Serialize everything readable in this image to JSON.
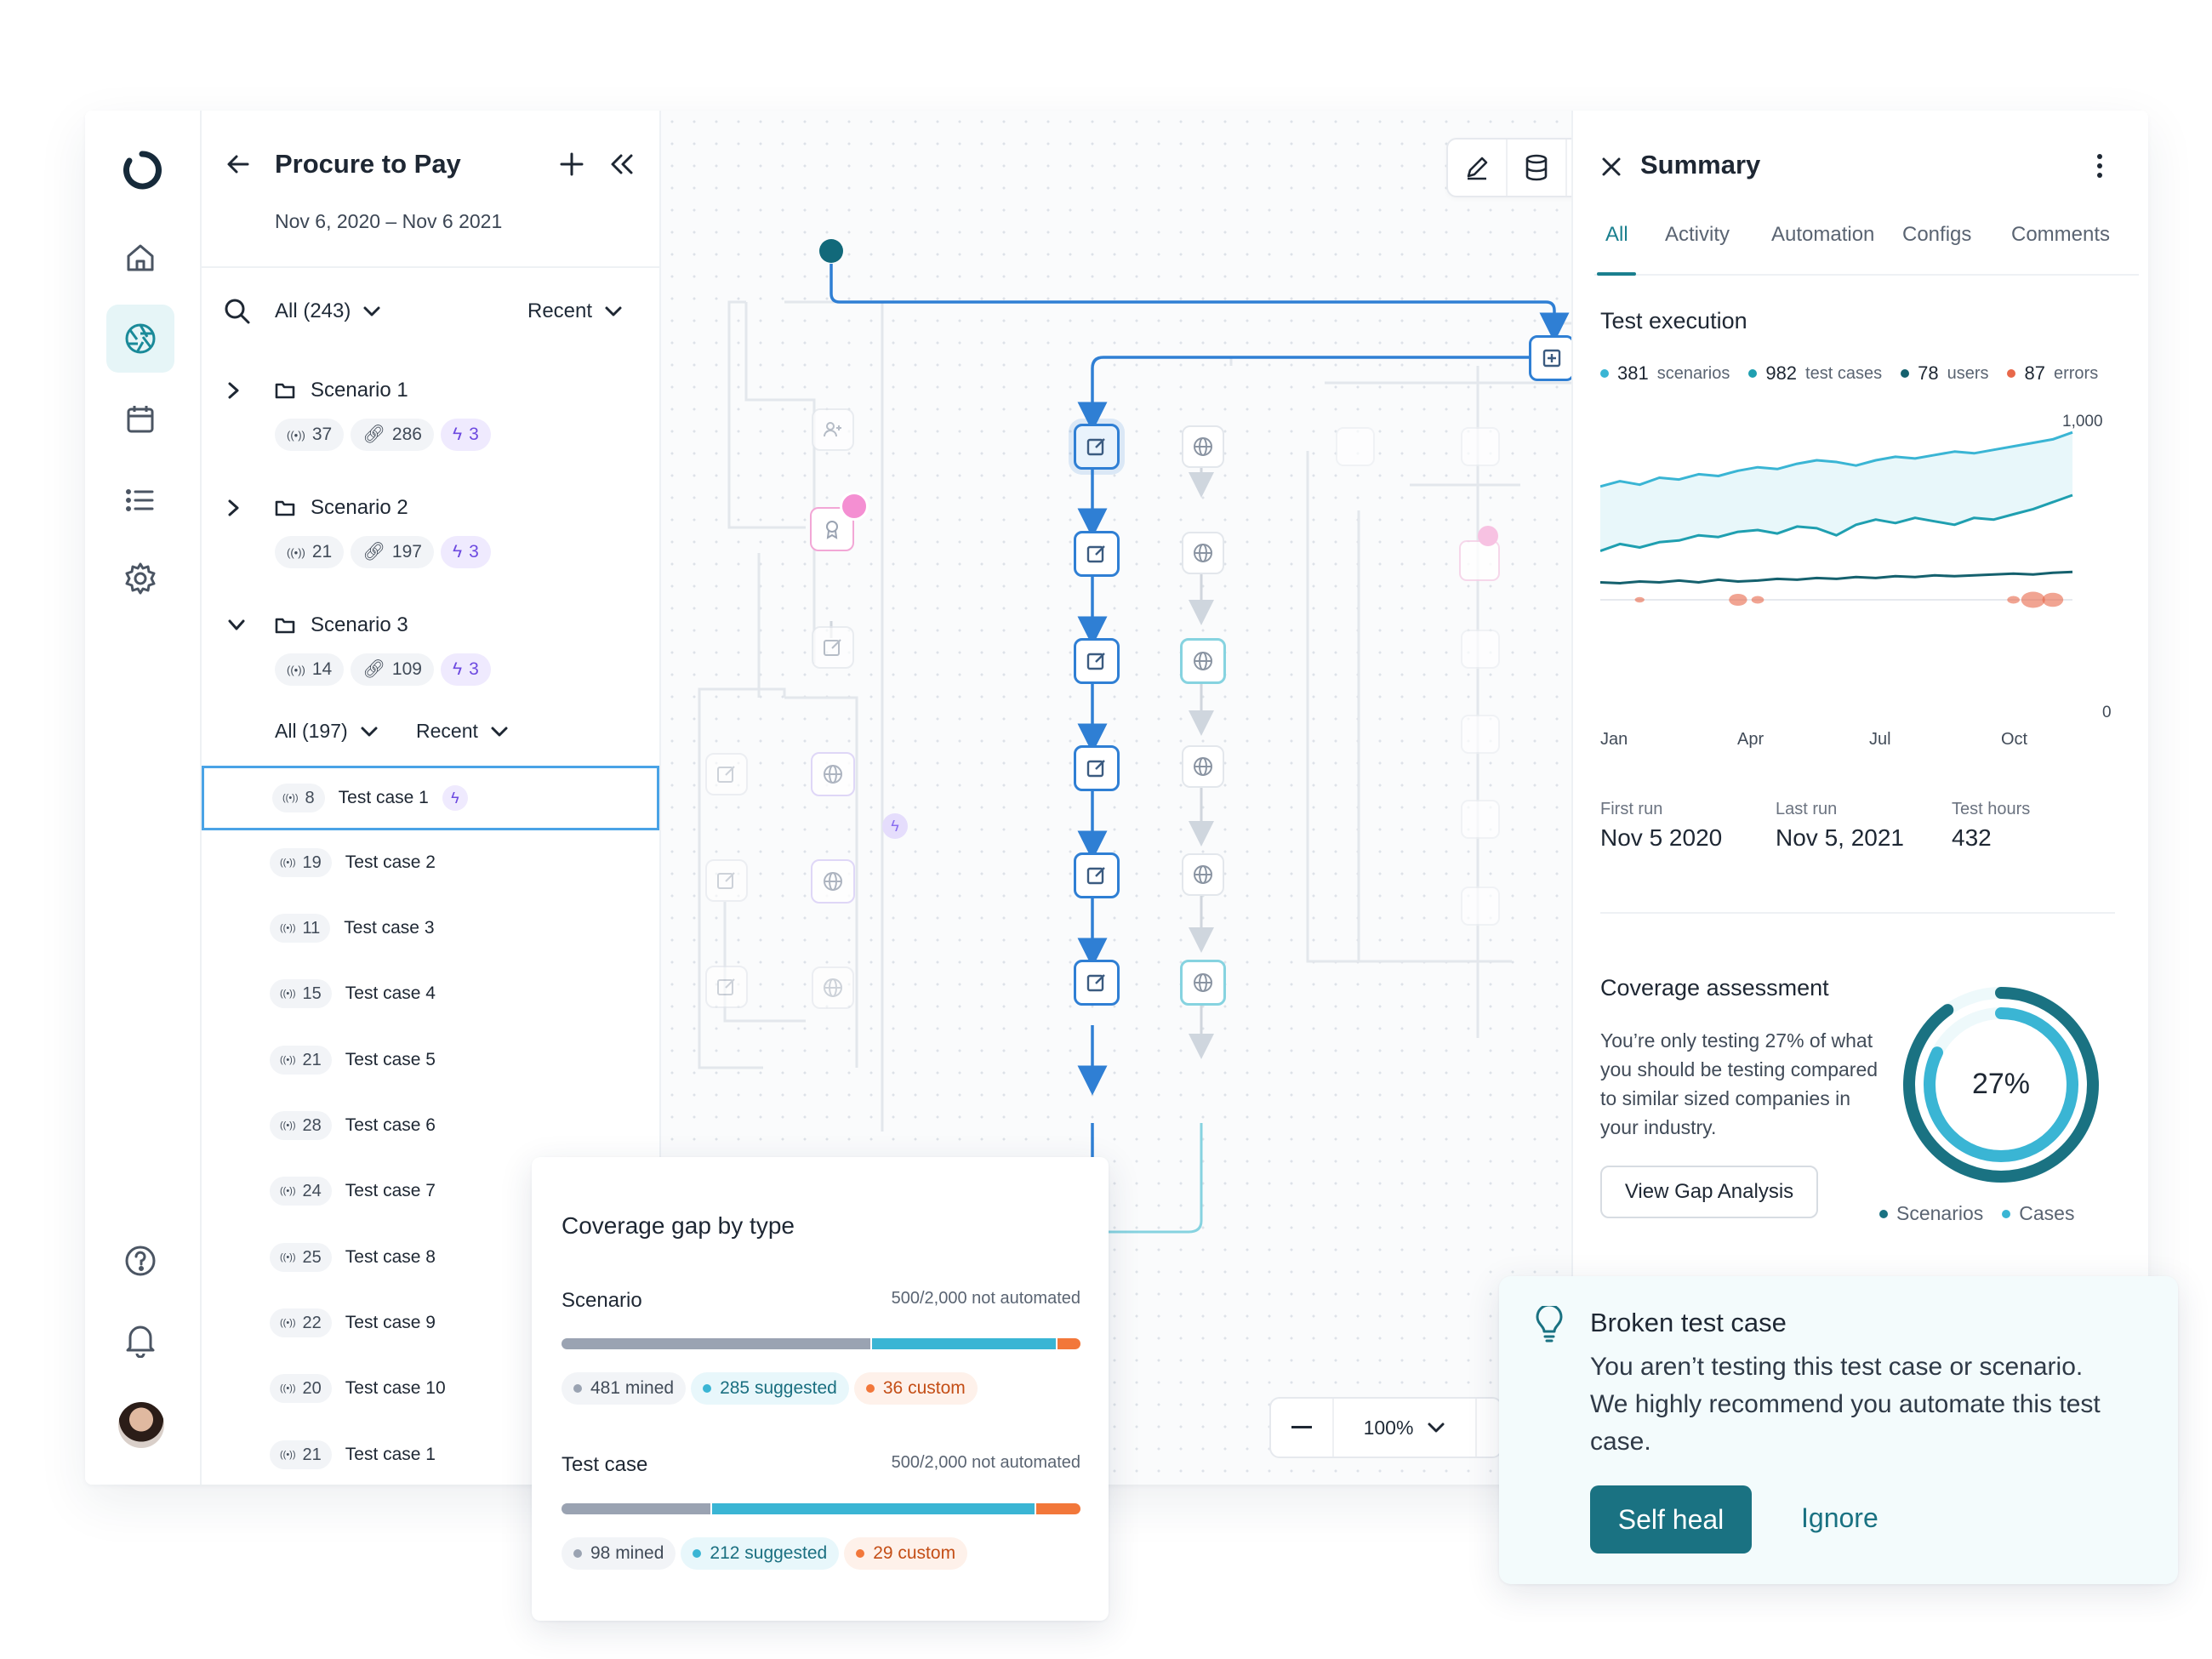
{
  "sidebar": {
    "logo_icon": "logo-ring-icon",
    "nav": [
      "home-icon",
      "aperture-icon",
      "calendar-icon",
      "list-icon",
      "gear-icon"
    ],
    "bottom": [
      "help-icon",
      "bell-icon",
      "avatar"
    ]
  },
  "panel": {
    "title": "Procure to Pay",
    "date_range": "Nov 6, 2020 – Nov 6 2021",
    "filter_label": "All (243)",
    "sort_label": "Recent",
    "scenarios": [
      {
        "name": "Scenario 1",
        "runs": "37",
        "links": "286",
        "bolts": "3"
      },
      {
        "name": "Scenario 2",
        "runs": "21",
        "links": "197",
        "bolts": "3"
      },
      {
        "name": "Scenario 3",
        "runs": "14",
        "links": "109",
        "bolts": "3"
      }
    ],
    "sub_filter_label": "All (197)",
    "sub_sort_label": "Recent",
    "test_cases": [
      {
        "num": "8",
        "name": "Test case 1"
      },
      {
        "num": "19",
        "name": "Test case 2"
      },
      {
        "num": "11",
        "name": "Test case 3"
      },
      {
        "num": "15",
        "name": "Test case 4"
      },
      {
        "num": "21",
        "name": "Test case 5"
      },
      {
        "num": "28",
        "name": "Test case 6"
      },
      {
        "num": "24",
        "name": "Test case 7"
      },
      {
        "num": "25",
        "name": "Test case 8"
      },
      {
        "num": "22",
        "name": "Test case 9"
      },
      {
        "num": "20",
        "name": "Test case 10"
      },
      {
        "num": "21",
        "name": "Test case 1"
      }
    ]
  },
  "canvas": {
    "toolbar": [
      "pen-icon",
      "database-icon",
      "refresh-icon"
    ],
    "zoom_level": "100%"
  },
  "summary": {
    "title": "Summary",
    "tabs": [
      "All",
      "Activity",
      "Automation",
      "Configs",
      "Comments"
    ],
    "active_tab": "All",
    "test_execution_title": "Test execution",
    "legend": [
      {
        "value": "381",
        "label": "scenarios",
        "color": "#3ab5d4"
      },
      {
        "value": "982",
        "label": "test cases",
        "color": "#1f9fb0"
      },
      {
        "value": "78",
        "label": "users",
        "color": "#15616e"
      },
      {
        "value": "87",
        "label": "errors",
        "color": "#e8684a"
      }
    ],
    "first_run_label": "First run",
    "first_run_value": "Nov 5 2020",
    "last_run_label": "Last run",
    "last_run_value": "Nov 5, 2021",
    "test_hours_label": "Test hours",
    "test_hours_value": "432",
    "coverage_title": "Coverage assessment",
    "coverage_text": "You’re only testing 27% of what you should be testing compared to similar sized companies in your industry.",
    "coverage_button": "View Gap Analysis",
    "coverage_percent": "27%",
    "coverage_fraction": 0.27,
    "donut_legend": [
      "Scenarios",
      "Cases"
    ]
  },
  "chart_data": {
    "type": "line",
    "x_ticks": [
      "Jan",
      "Apr",
      "Jul",
      "Oct"
    ],
    "y_ticks": [
      "1,000",
      "0"
    ],
    "ylim": [
      0,
      1000
    ],
    "series": [
      {
        "name": "scenarios",
        "color": "#3ab5d4",
        "values": [
          650,
          680,
          660,
          700,
          690,
          720,
          710,
          740,
          760,
          750,
          780,
          800,
          790,
          770,
          800,
          820,
          810,
          830,
          850,
          840,
          860,
          880,
          900,
          920,
          960
        ]
      },
      {
        "name": "test cases",
        "color": "#1f9fb0",
        "values": [
          280,
          320,
          300,
          330,
          340,
          370,
          360,
          390,
          400,
          380,
          420,
          410,
          370,
          430,
          460,
          440,
          470,
          450,
          430,
          470,
          460,
          490,
          520,
          560,
          600
        ]
      },
      {
        "name": "users",
        "color": "#15616e",
        "values": [
          100,
          95,
          105,
          100,
          110,
          100,
          115,
          105,
          110,
          120,
          115,
          125,
          120,
          130,
          125,
          135,
          130,
          140,
          135,
          140,
          145,
          150,
          145,
          155,
          160
        ]
      },
      {
        "name": "errors",
        "color": "#e8684a",
        "values": [
          0,
          0,
          5,
          0,
          0,
          0,
          0,
          20,
          10,
          0,
          0,
          0,
          0,
          0,
          0,
          0,
          0,
          0,
          0,
          0,
          0,
          10,
          30,
          25,
          0
        ]
      }
    ]
  },
  "gap_card": {
    "title": "Coverage gap by type",
    "rows": [
      {
        "label": "Scenario",
        "status": "500/2,000 not automated",
        "segments": [
          {
            "value": 481,
            "color": "#9aa3b2"
          },
          {
            "value": 285,
            "color": "#3ab5d4"
          },
          {
            "value": 36,
            "color": "#f2773a"
          }
        ],
        "chips": [
          {
            "text": "481 mined",
            "dot": "#9aa3b2",
            "bg": "#f2f4f7",
            "fg": "#414b58"
          },
          {
            "text": "285 suggested",
            "dot": "#3ab5d4",
            "bg": "#e8f7fb",
            "fg": "#1a6f80"
          },
          {
            "text": "36 custom",
            "dot": "#f2773a",
            "bg": "#fef1ea",
            "fg": "#c44e16"
          }
        ]
      },
      {
        "label": "Test case",
        "status": "500/2,000 not automated",
        "segments": [
          {
            "value": 98,
            "color": "#9aa3b2"
          },
          {
            "value": 212,
            "color": "#3ab5d4"
          },
          {
            "value": 29,
            "color": "#f2773a"
          }
        ],
        "chips": [
          {
            "text": "98 mined",
            "dot": "#9aa3b2",
            "bg": "#f2f4f7",
            "fg": "#414b58"
          },
          {
            "text": "212 suggested",
            "dot": "#3ab5d4",
            "bg": "#e8f7fb",
            "fg": "#1a6f80"
          },
          {
            "text": "29 custom",
            "dot": "#f2773a",
            "bg": "#fef1ea",
            "fg": "#c44e16"
          }
        ]
      }
    ]
  },
  "broken_card": {
    "title": "Broken test case",
    "message": "You aren’t testing this test case or scenario. We highly recommend you automate this test case.",
    "primary_button": "Self heal",
    "secondary_button": "Ignore"
  },
  "colors": {
    "accent": "#1a7f8e",
    "flow_blue": "#2f7fd4",
    "selected_border": "#4aa3e6",
    "bolt_purple": "#6d4ae0"
  }
}
